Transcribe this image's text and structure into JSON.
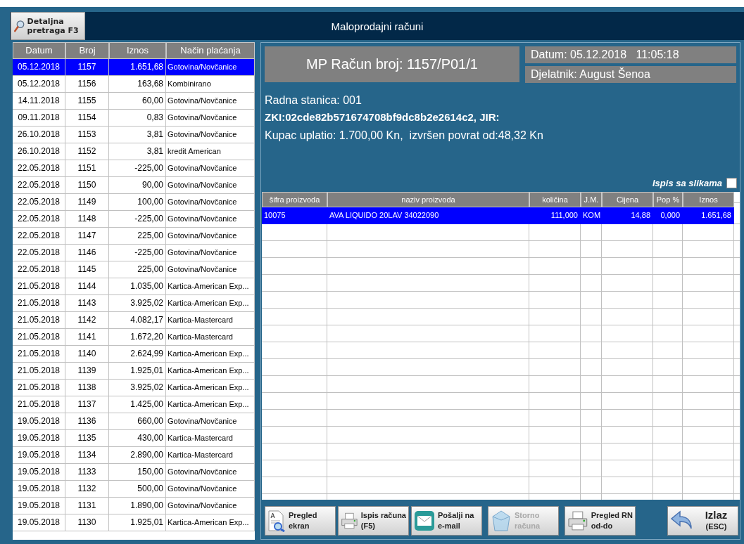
{
  "header": {
    "search_button": "Detaljna pretraga F3",
    "title": "Maloprodajni računi"
  },
  "invoices": {
    "columns": [
      "Datum",
      "Broj",
      "Iznos",
      "Način plaćanja"
    ],
    "rows": [
      {
        "date": "05.12.2018",
        "number": "1157",
        "amount": "1.651,68",
        "payment": "Gotovina/Novčanice",
        "selected": true
      },
      {
        "date": "05.12.2018",
        "number": "1156",
        "amount": "163,68",
        "payment": "Kombinirano",
        "selected": false
      },
      {
        "date": "14.11.2018",
        "number": "1155",
        "amount": "60,00",
        "payment": "Gotovina/Novčanice",
        "selected": false
      },
      {
        "date": "09.11.2018",
        "number": "1154",
        "amount": "0,83",
        "payment": "Gotovina/Novčanice",
        "selected": false
      },
      {
        "date": "26.10.2018",
        "number": "1153",
        "amount": "3,81",
        "payment": "Gotovina/Novčanice",
        "selected": false
      },
      {
        "date": "26.10.2018",
        "number": "1152",
        "amount": "3,81",
        "payment": "kredit American",
        "selected": false
      },
      {
        "date": "22.05.2018",
        "number": "1151",
        "amount": "-225,00",
        "payment": "Gotovina/Novčanice",
        "selected": false
      },
      {
        "date": "22.05.2018",
        "number": "1150",
        "amount": "90,00",
        "payment": "Gotovina/Novčanice",
        "selected": false
      },
      {
        "date": "22.05.2018",
        "number": "1149",
        "amount": "100,00",
        "payment": "Gotovina/Novčanice",
        "selected": false
      },
      {
        "date": "22.05.2018",
        "number": "1148",
        "amount": "-225,00",
        "payment": "Gotovina/Novčanice",
        "selected": false
      },
      {
        "date": "22.05.2018",
        "number": "1147",
        "amount": "225,00",
        "payment": "Gotovina/Novčanice",
        "selected": false
      },
      {
        "date": "22.05.2018",
        "number": "1146",
        "amount": "-225,00",
        "payment": "Gotovina/Novčanice",
        "selected": false
      },
      {
        "date": "22.05.2018",
        "number": "1145",
        "amount": "225,00",
        "payment": "Gotovina/Novčanice",
        "selected": false
      },
      {
        "date": "21.05.2018",
        "number": "1144",
        "amount": "1.035,00",
        "payment": "Kartica-American Exp...",
        "selected": false
      },
      {
        "date": "21.05.2018",
        "number": "1143",
        "amount": "3.925,02",
        "payment": "Kartica-American Exp...",
        "selected": false
      },
      {
        "date": "21.05.2018",
        "number": "1142",
        "amount": "4.082,17",
        "payment": "Kartica-Mastercard",
        "selected": false
      },
      {
        "date": "21.05.2018",
        "number": "1141",
        "amount": "1.672,20",
        "payment": "Kartica-Mastercard",
        "selected": false
      },
      {
        "date": "21.05.2018",
        "number": "1140",
        "amount": "2.624,99",
        "payment": "Kartica-American Exp...",
        "selected": false
      },
      {
        "date": "21.05.2018",
        "number": "1139",
        "amount": "1.925,01",
        "payment": "Kartica-American Exp...",
        "selected": false
      },
      {
        "date": "21.05.2018",
        "number": "1138",
        "amount": "3.925,02",
        "payment": "Kartica-American Exp...",
        "selected": false
      },
      {
        "date": "21.05.2018",
        "number": "1137",
        "amount": "1.425,00",
        "payment": "Kartica-American Exp...",
        "selected": false
      },
      {
        "date": "19.05.2018",
        "number": "1136",
        "amount": "660,00",
        "payment": "Gotovina/Novčanice",
        "selected": false
      },
      {
        "date": "19.05.2018",
        "number": "1135",
        "amount": "430,00",
        "payment": "Kartica-Mastercard",
        "selected": false
      },
      {
        "date": "19.05.2018",
        "number": "1134",
        "amount": "2.890,00",
        "payment": "Kartica-Mastercard",
        "selected": false
      },
      {
        "date": "19.05.2018",
        "number": "1133",
        "amount": "150,00",
        "payment": "Gotovina/Novčanice",
        "selected": false
      },
      {
        "date": "19.05.2018",
        "number": "1132",
        "amount": "500,00",
        "payment": "Gotovina/Novčanice",
        "selected": false
      },
      {
        "date": "19.05.2018",
        "number": "1131",
        "amount": "1.890,00",
        "payment": "Gotovina/Novčanice",
        "selected": false
      },
      {
        "date": "19.05.2018",
        "number": "1130",
        "amount": "1.925,01",
        "payment": "Kartica-American Exp...",
        "selected": false
      }
    ]
  },
  "detail": {
    "receipt_title": "MP Račun broj: 1157/P01/1",
    "date": "Datum: 05.12.2018   11:05:18",
    "employee": "Djelatnik: August Šenoa",
    "workstation": "Radna stanica: 001",
    "zki": "ZKI:02cde82b571674708bf9dc8b2e2614c2, JIR:",
    "payment_info": "Kupac uplatio: 1.700,00 Kn,  izvršen povrat od:48,32 Kn",
    "images_option": {
      "label": "Ispis sa slikama",
      "checked": false
    }
  },
  "items": {
    "columns": [
      "šifra proizvoda",
      "naziv proizvoda",
      "količina",
      "J.M.",
      "Cijena",
      "Pop %",
      "Iznos"
    ],
    "rows": [
      {
        "cells": [
          "10075",
          "AVA LIQUIDO 20LAV 34022090",
          "111,000",
          "KOM",
          "14,88",
          "0,000",
          "1.651,68"
        ],
        "selected": true
      }
    ]
  },
  "actions": [
    {
      "kind": "preview",
      "lines": [
        "Pregled",
        "ekran"
      ],
      "disabled": false
    },
    {
      "kind": "print",
      "lines": [
        "Ispis računa",
        "(F5)"
      ],
      "disabled": false
    },
    {
      "kind": "mail",
      "lines": [
        "Pošalji na",
        "e-mail"
      ],
      "disabled": false
    },
    {
      "kind": "storno",
      "lines": [
        "Storno",
        "računa"
      ],
      "disabled": true
    },
    {
      "kind": "print",
      "lines": [
        "Pregled RN",
        "od-do"
      ],
      "disabled": false
    },
    {
      "kind": "exit",
      "lines": [
        "Izlaz",
        "(ESC)"
      ],
      "disabled": false
    }
  ]
}
